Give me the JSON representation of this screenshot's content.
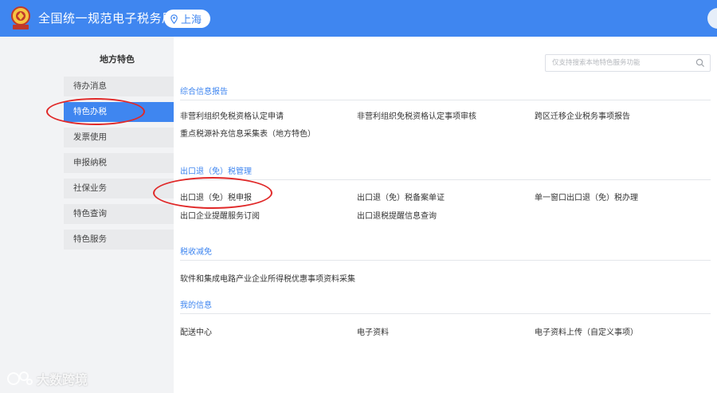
{
  "header": {
    "title": "全国统一规范电子税务局",
    "region": "上海"
  },
  "sidebar": {
    "title": "地方特色",
    "items": [
      {
        "label": "待办消息"
      },
      {
        "label": "特色办税"
      },
      {
        "label": "发票使用"
      },
      {
        "label": "申报纳税"
      },
      {
        "label": "社保业务"
      },
      {
        "label": "特色查询"
      },
      {
        "label": "特色服务"
      }
    ],
    "active_index": 1
  },
  "search": {
    "placeholder": "仅支持搜索本地特色服务功能"
  },
  "sections": [
    {
      "title": "综合信息报告",
      "links": [
        "非营利组织免税资格认定申请",
        "非营利组织免税资格认定事项审核",
        "跨区迁移企业税务事项报告",
        "重点税源补充信息采集表（地方特色）"
      ]
    },
    {
      "title": "出口退（免）税管理",
      "links": [
        "出口退（免）税申报",
        "出口退（免）税备案单证",
        "单一窗口出口退（免）税办理",
        "出口企业提醒服务订阅",
        "出口退税提醒信息查询"
      ]
    },
    {
      "title": "税收减免",
      "links": [
        "软件和集成电路产业企业所得税优惠事项资料采集"
      ]
    },
    {
      "title": "我的信息",
      "links": [
        "配送中心",
        "电子资料",
        "电子资料上传（自定义事项）"
      ]
    }
  ],
  "watermark": {
    "text": "大数跨境"
  },
  "colors": {
    "header_blue": "#3f86f0",
    "active_blue": "#3f86f0",
    "annotation_red": "#e02828"
  }
}
